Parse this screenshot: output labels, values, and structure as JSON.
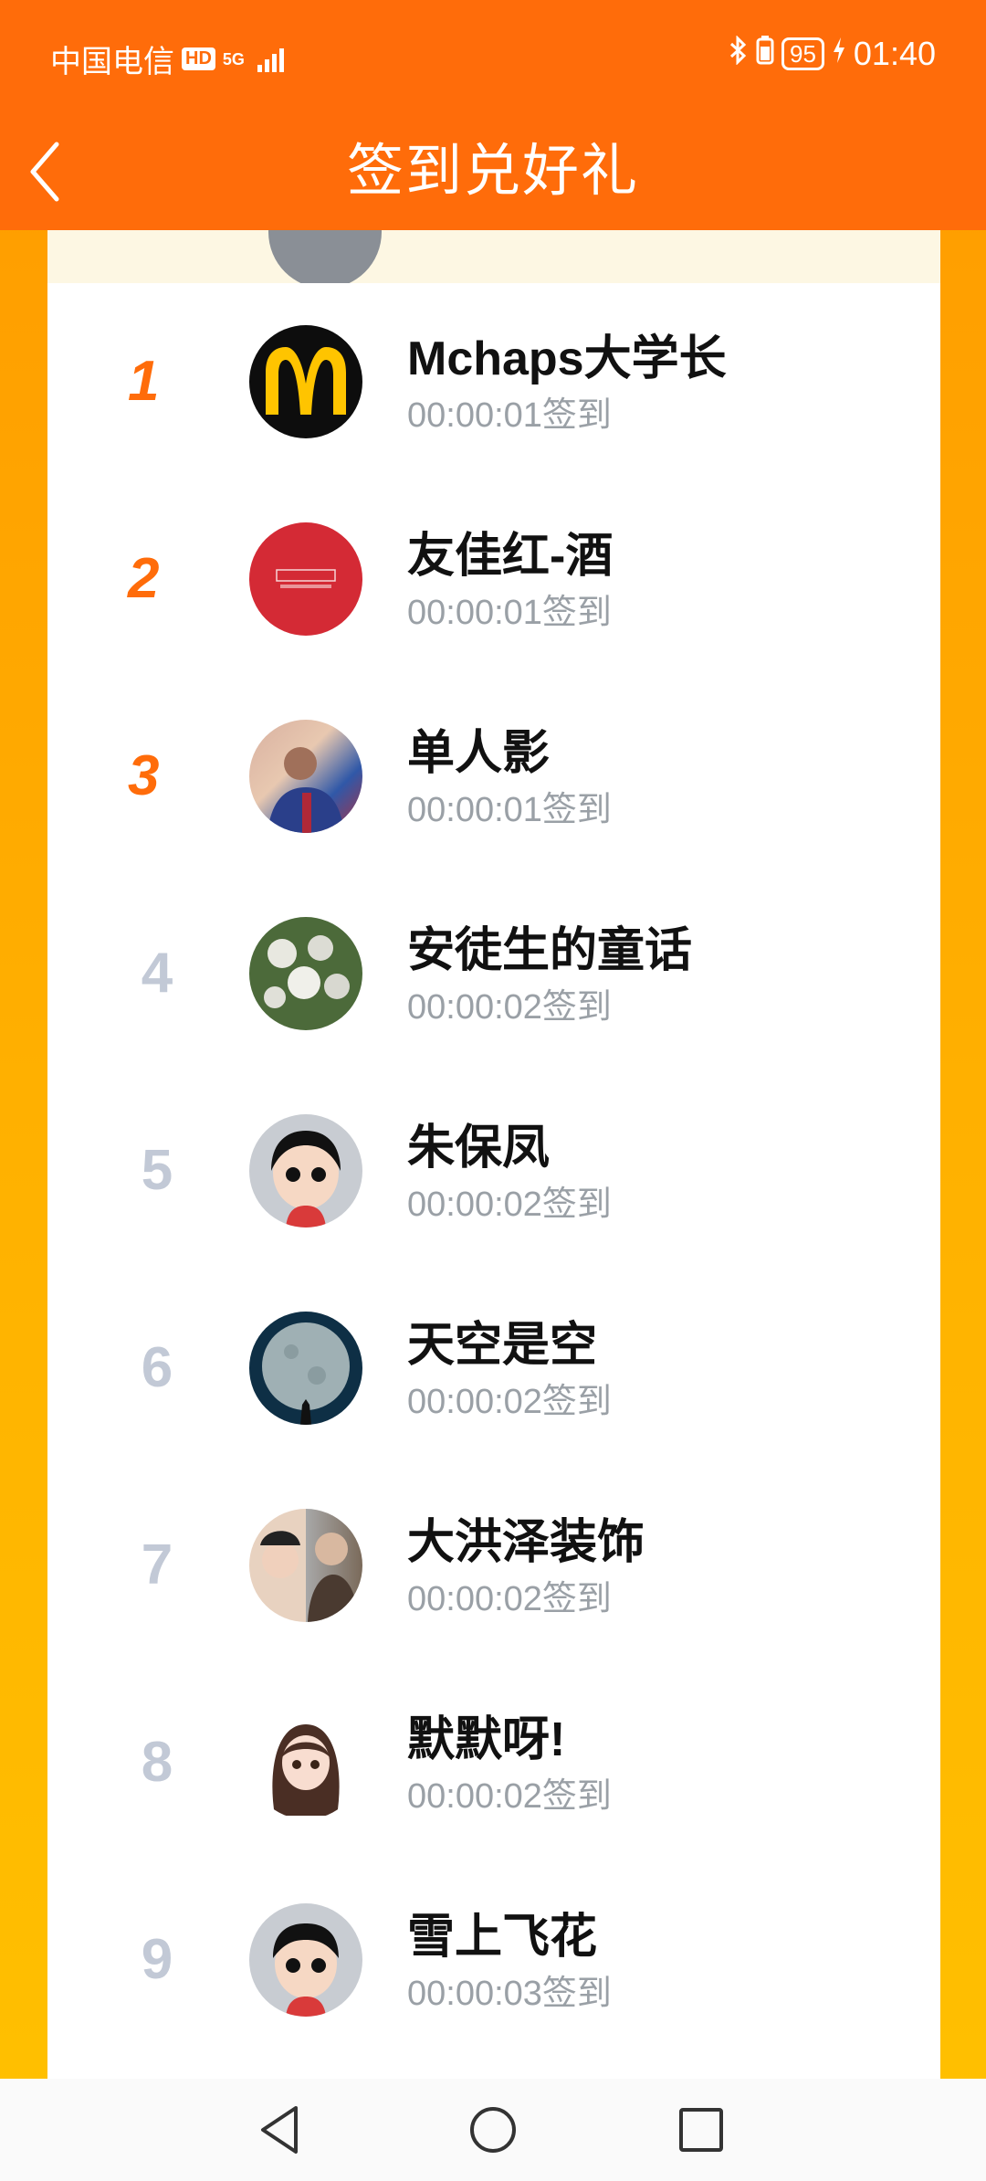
{
  "status": {
    "carrier": "中国电信",
    "hd": "HD",
    "network": "5G",
    "battery": "95",
    "time": "01:40"
  },
  "header": {
    "title": "签到兑好礼"
  },
  "list": [
    {
      "rank": "1",
      "name": "Mchaps大学长",
      "time": "00:00:01签到"
    },
    {
      "rank": "2",
      "name": "友佳红-酒",
      "time": "00:00:01签到"
    },
    {
      "rank": "3",
      "name": "单人影",
      "time": "00:00:01签到"
    },
    {
      "rank": "4",
      "name": "安徒生的童话",
      "time": "00:00:02签到"
    },
    {
      "rank": "5",
      "name": "朱保凤",
      "time": "00:00:02签到"
    },
    {
      "rank": "6",
      "name": "天空是空",
      "time": "00:00:02签到"
    },
    {
      "rank": "7",
      "name": "大洪泽装饰",
      "time": "00:00:02签到"
    },
    {
      "rank": "8",
      "name": "默默呀!",
      "time": "00:00:02签到"
    },
    {
      "rank": "9",
      "name": "雪上飞花",
      "time": "00:00:03签到"
    }
  ],
  "colors": {
    "header": "#ff6c0a",
    "top_rank": "#ff6c0a",
    "rank": "#c2c9d6",
    "card_top": "#fdf7e3"
  },
  "icons": [
    "back-arrow-icon",
    "bluetooth-icon",
    "battery-icon",
    "charging-icon",
    "signal-icon",
    "nav-back-icon",
    "nav-home-icon",
    "nav-recents-icon"
  ]
}
